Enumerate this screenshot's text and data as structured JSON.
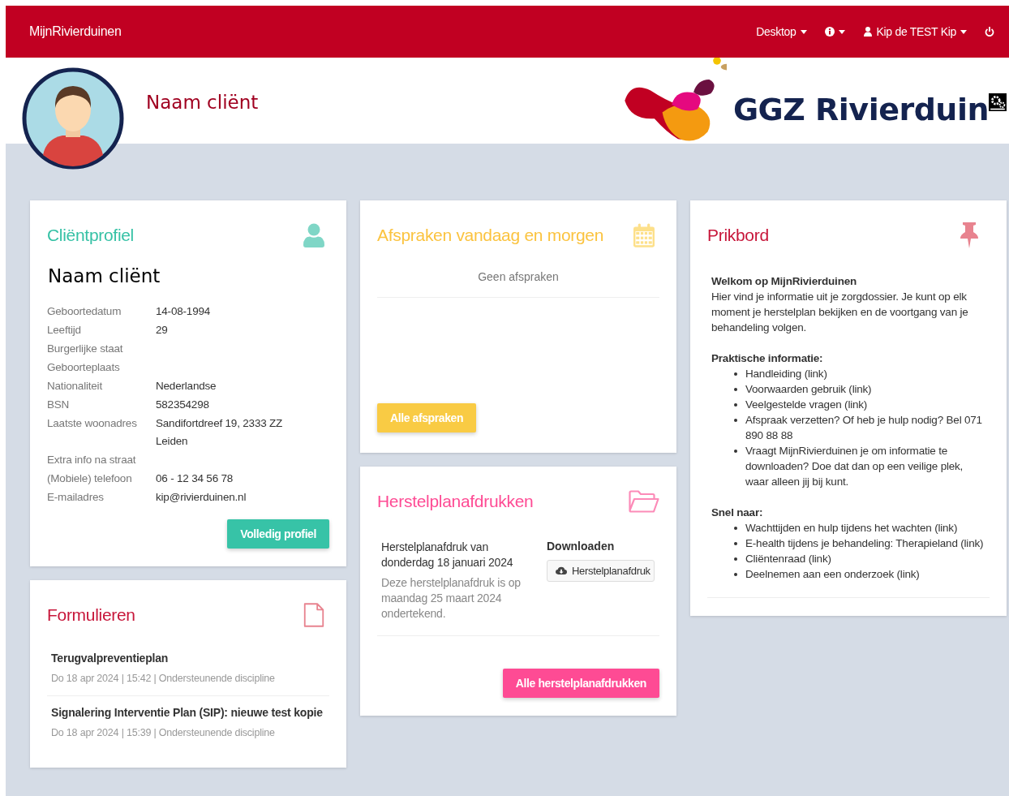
{
  "navbar": {
    "brand": "MijnRivierduinen",
    "menus": [
      {
        "kind": "text",
        "label": "Desktop"
      },
      {
        "kind": "info"
      },
      {
        "kind": "user",
        "label": "Kip de TEST Kip"
      },
      {
        "kind": "power"
      }
    ]
  },
  "header": {
    "name": "Naam cliënt",
    "logo_text": "GGZ Rivierduin"
  },
  "profile": {
    "title": "Cliëntprofiel",
    "name": "Naam cliënt",
    "fields": [
      {
        "label": "Geboortedatum",
        "value": "14-08-1994"
      },
      {
        "label": "Leeftijd",
        "value": "29"
      },
      {
        "label": "Burgerlijke staat"
      },
      {
        "label": "Geboorteplaats"
      },
      {
        "label": "Nationaliteit",
        "value": "Nederlandse"
      },
      {
        "label": "BSN",
        "value": "582354298"
      },
      {
        "label": "Laatste woonadres",
        "value": "Sandifortdreef 19, 2333 ZZ Leiden"
      },
      {
        "label": "Extra info na straat"
      },
      {
        "label": "(Mobiele) telefoon",
        "value": "06 - 12 34 56 78"
      },
      {
        "label": "E-mailadres",
        "value": "kip@rivierduinen.nl"
      }
    ],
    "button": "Volledig profiel"
  },
  "forms": {
    "title": "Formulieren",
    "items": [
      {
        "title": "Terugvalpreventieplan",
        "meta": "Do 18 apr 2024 | 15:42 | Ondersteunende discipline"
      },
      {
        "title": "Signalering Interventie Plan (SIP): nieuwe test kopie",
        "meta": "Do 18 apr 2024 | 15:39 | Ondersteunende discipline"
      }
    ]
  },
  "appointments": {
    "title": "Afspraken vandaag en morgen",
    "empty": "Geen afspraken",
    "button": "Alle afspraken"
  },
  "recovery": {
    "title": "Herstelplanafdrukken",
    "items": [
      {
        "title": "Herstelplanafdruk van donderdag 18 januari 2024",
        "note": "Deze herstelplanafdruk is op maandag 25 maart 2024 ondertekend.",
        "download_heading": "Downloaden",
        "download_button": "Herstelplanafdruk"
      }
    ],
    "button": "Alle herstelplanafdrukken"
  },
  "board": {
    "title": "Prikbord",
    "welcome_title": "Welkom op MijnRivierduinen",
    "welcome_text": "Hier vind je informatie uit je zorgdossier. Je kunt op elk moment je herstelplan bekijken en de voortgang van je behandeling volgen.",
    "sections": [
      {
        "heading": "Praktische informatie:",
        "items": [
          "Handleiding (link)",
          "Voorwaarden gebruik (link)",
          "Veelgestelde vragen (link)",
          "Afspraak verzetten? Of heb je hulp nodig? Bel 071 890 88 88",
          "Vraagt MijnRivierduinen je om informatie te downloaden? Doe dat dan op een veilige plek, waar alleen jij bij kunt."
        ]
      },
      {
        "heading": "Snel naar:",
        "items": [
          "Wachttijden en hulp tijdens het wachten (link)",
          "E-health tijdens je behandeling: Therapieland (link)",
          "Cliëntenraad (link)",
          "Deelnemen aan een onderzoek (link)"
        ]
      }
    ]
  }
}
